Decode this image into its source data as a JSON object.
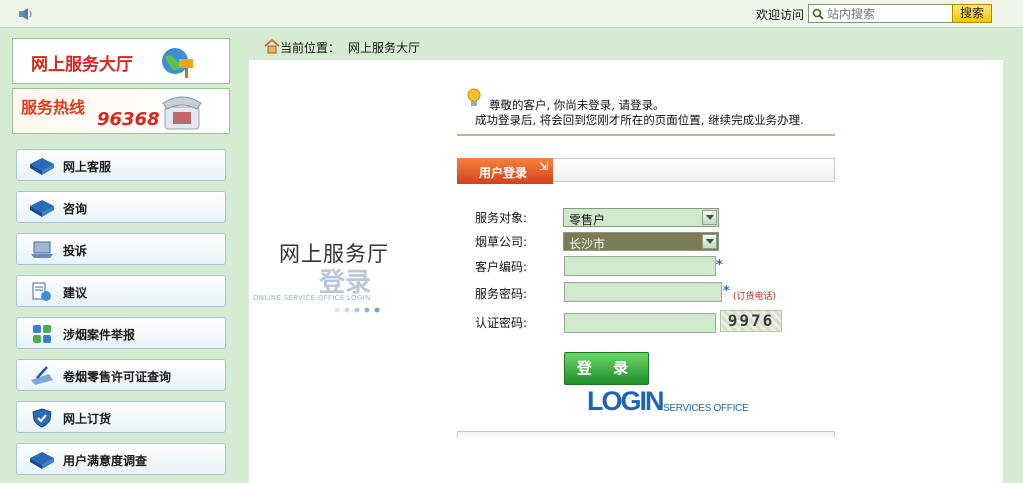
{
  "topbar": {
    "welcome_text": "欢迎访问",
    "search_placeholder": "站内搜索",
    "search_button": "搜索"
  },
  "sidebar": {
    "banner_service_hall": "网上服务大厅",
    "banner_hotline_label": "服务热线",
    "banner_hotline_number": "96368",
    "items": [
      {
        "label": "网上客服",
        "icon": "blue-book-icon"
      },
      {
        "label": "咨询",
        "icon": "blue-book-icon"
      },
      {
        "label": "投诉",
        "icon": "laptop-icon"
      },
      {
        "label": "建议",
        "icon": "document-globe-icon"
      },
      {
        "label": "涉烟案件举报",
        "icon": "grid-blocks-icon"
      },
      {
        "label": "卷烟零售许可证查询",
        "icon": "pen-document-icon"
      },
      {
        "label": "网上订货",
        "icon": "shield-icon"
      },
      {
        "label": "用户满意度调查",
        "icon": "blue-book-icon"
      }
    ]
  },
  "breadcrumb": {
    "label": "当前位置：",
    "value": "网上服务大厅"
  },
  "logo": {
    "title_cn": "网上服务厅",
    "title_cn2": "登录",
    "title_en": "ONLINE SERVICE OFFICE LOGIN"
  },
  "notice": {
    "line1": "尊敬的客户, 你尚未登录, 请登录。",
    "line2": "成功登录后, 将会回到您刚才所在的页面位置, 继续完成业务办理."
  },
  "login_form": {
    "tab_label": "用户登录",
    "fields": {
      "service_target_label": "服务对象:",
      "service_target_value": "零售户",
      "tobacco_company_label": "烟草公司:",
      "tobacco_company_value": "长沙市",
      "customer_code_label": "客户编码:",
      "service_password_label": "服务密码:",
      "service_password_hint": "(订货电话)",
      "captcha_label": "认证密码:",
      "captcha_value": "9976"
    },
    "submit_label": "登 录",
    "brand_big": "LOGIN",
    "brand_small": "SERVICES OFFICE"
  },
  "colors": {
    "page_bg": "#d6ecd2",
    "field_bg": "#cfeacb",
    "tab_orange": "#e05a24",
    "login_green": "#2a9a30",
    "brand_blue": "#1d63b8",
    "accent_red": "#d9261c"
  }
}
